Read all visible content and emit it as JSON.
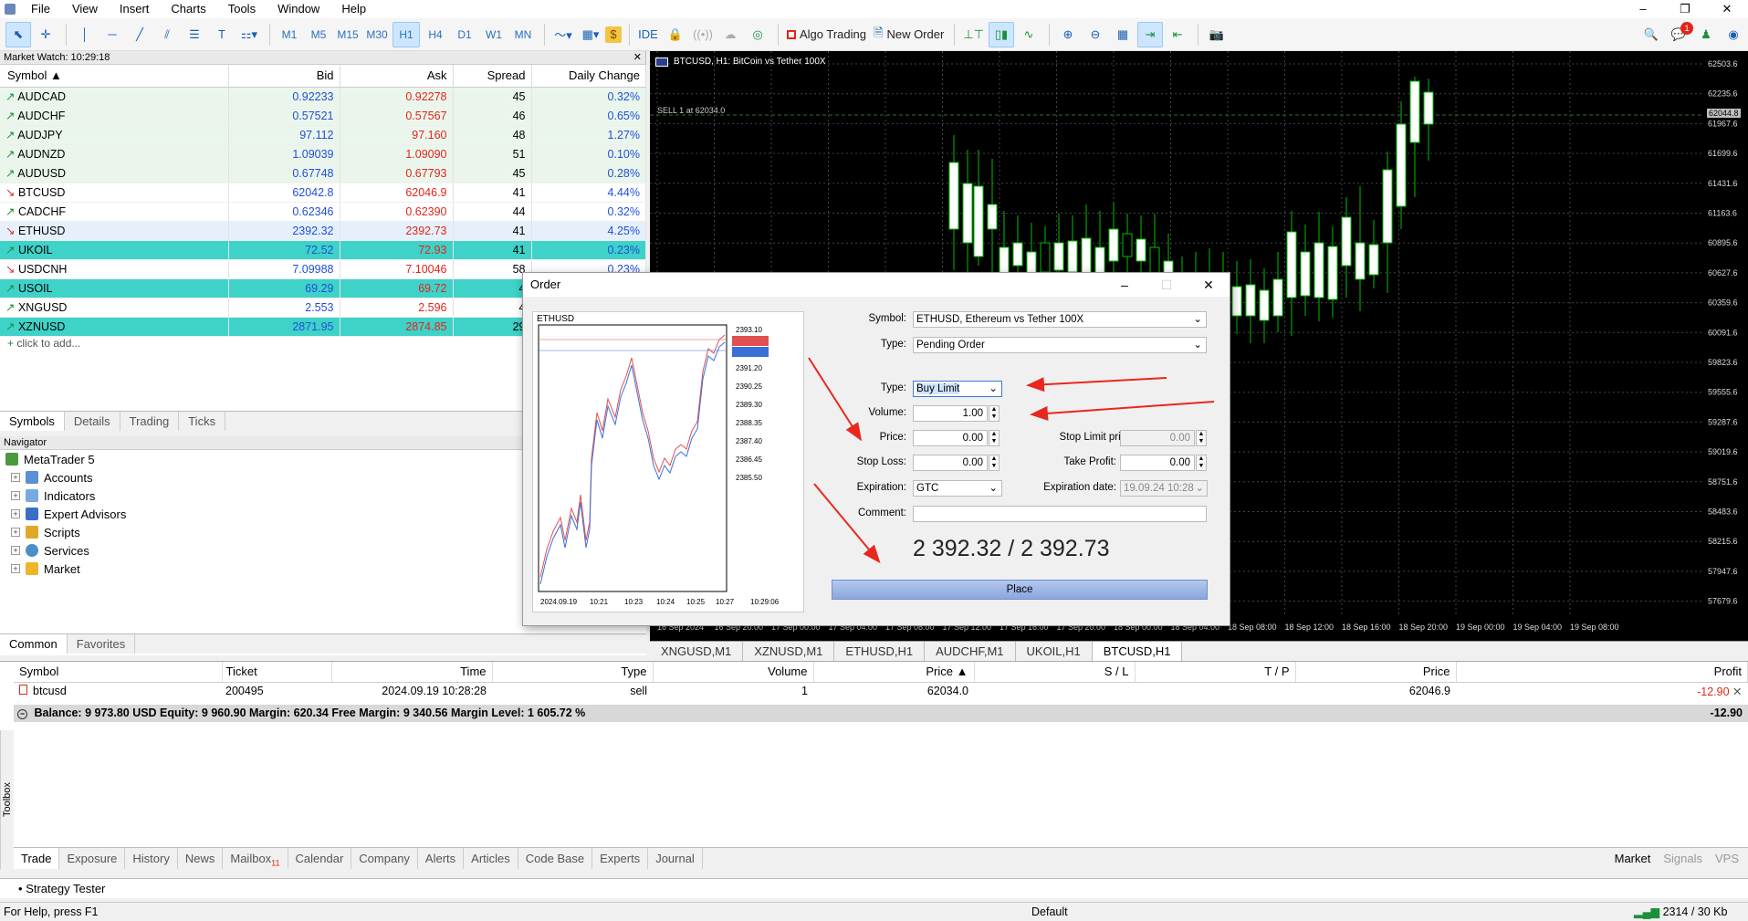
{
  "menu": [
    "File",
    "View",
    "Insert",
    "Charts",
    "Tools",
    "Window",
    "Help"
  ],
  "toolbar": {
    "timeframes": [
      "M1",
      "M5",
      "M15",
      "M30",
      "H1",
      "H4",
      "D1",
      "W1",
      "MN"
    ],
    "active_timeframe": "H1",
    "ide": "IDE",
    "algo": "Algo Trading",
    "new_order": "New Order",
    "notif_count": "1"
  },
  "market_watch": {
    "title": "Market Watch: 10:29:18",
    "columns": [
      "Symbol",
      "Bid",
      "Ask",
      "Spread",
      "Daily Change"
    ],
    "rows": [
      {
        "symbol": "AUDCAD",
        "bid": "0.92233",
        "ask": "0.92278",
        "spread": "45",
        "change": "0.32%",
        "dir": "up"
      },
      {
        "symbol": "AUDCHF",
        "bid": "0.57521",
        "ask": "0.57567",
        "spread": "46",
        "change": "0.65%",
        "dir": "up"
      },
      {
        "symbol": "AUDJPY",
        "bid": "97.112",
        "ask": "97.160",
        "spread": "48",
        "change": "1.27%",
        "dir": "up"
      },
      {
        "symbol": "AUDNZD",
        "bid": "1.09039",
        "ask": "1.09090",
        "spread": "51",
        "change": "0.10%",
        "dir": "up"
      },
      {
        "symbol": "AUDUSD",
        "bid": "0.67748",
        "ask": "0.67793",
        "spread": "45",
        "change": "0.28%",
        "dir": "up"
      },
      {
        "symbol": "BTCUSD",
        "bid": "62042.8",
        "ask": "62046.9",
        "spread": "41",
        "change": "4.44%",
        "dir": "dn"
      },
      {
        "symbol": "CADCHF",
        "bid": "0.62346",
        "ask": "0.62390",
        "spread": "44",
        "change": "0.32%",
        "dir": "up"
      },
      {
        "symbol": "ETHUSD",
        "bid": "2392.32",
        "ask": "2392.73",
        "spread": "41",
        "change": "4.25%",
        "dir": "dn"
      },
      {
        "symbol": "UKOIL",
        "bid": "72.52",
        "ask": "72.93",
        "spread": "41",
        "change": "0.23%",
        "dir": "up"
      },
      {
        "symbol": "USDCNH",
        "bid": "7.09988",
        "ask": "7.10046",
        "spread": "58",
        "change": "0.23%",
        "dir": "dn"
      },
      {
        "symbol": "USOIL",
        "bid": "69.29",
        "ask": "69.72",
        "spread": "4",
        "change": "",
        "dir": "up"
      },
      {
        "symbol": "XNGUSD",
        "bid": "2.553",
        "ask": "2.596",
        "spread": "4",
        "change": "",
        "dir": "up"
      },
      {
        "symbol": "XZNUSD",
        "bid": "2871.95",
        "ask": "2874.85",
        "spread": "29",
        "change": "",
        "dir": "up"
      }
    ],
    "add": "click to add...",
    "tabs": [
      "Symbols",
      "Details",
      "Trading",
      "Ticks"
    ]
  },
  "navigator": {
    "title": "Navigator",
    "root": "MetaTrader 5",
    "items": [
      "Accounts",
      "Indicators",
      "Expert Advisors",
      "Scripts",
      "Services",
      "Market"
    ],
    "tabs": [
      "Common",
      "Favorites"
    ]
  },
  "chart": {
    "title": "BTCUSD, H1: BitCoin vs Tether 100X",
    "sell_line": "SELL 1 at 62034.0",
    "current_price": "62044.8",
    "price_ticks": [
      "62503.6",
      "62235.6",
      "61967.6",
      "61699.6",
      "61431.6",
      "61163.6",
      "60895.6",
      "60627.6",
      "60359.6",
      "60091.6",
      "59823.6",
      "59555.6",
      "59287.6",
      "59019.6",
      "58751.6",
      "58483.6",
      "58215.6",
      "57947.6",
      "57679.6"
    ],
    "time_ticks": [
      "16 Sep 2024",
      "16 Sep 20:00",
      "17 Sep 00:00",
      "17 Sep 04:00",
      "17 Sep 08:00",
      "17 Sep 12:00",
      "17 Sep 16:00",
      "17 Sep 20:00",
      "18 Sep 00:00",
      "18 Sep 04:00",
      "18 Sep 08:00",
      "18 Sep 12:00",
      "18 Sep 16:00",
      "18 Sep 20:00",
      "19 Sep 00:00",
      "19 Sep 04:00",
      "19 Sep 08:00"
    ],
    "tabs": [
      "XNGUSD,M1",
      "XZNUSD,M1",
      "ETHUSD,H1",
      "AUDCHF,M1",
      "UKOIL,H1",
      "BTCUSD,H1"
    ],
    "active_tab": "BTCUSD,H1"
  },
  "order": {
    "title": "Order",
    "symbol_label": "Symbol:",
    "symbol": "ETHUSD, Ethereum vs Tether 100X",
    "type_label": "Type:",
    "type": "Pending Order",
    "subtype_label": "Type:",
    "subtype": "Buy Limit",
    "volume_label": "Volume:",
    "volume": "1.00",
    "price_label": "Price:",
    "price": "0.00",
    "stop_limit_label": "Stop Limit price:",
    "stop_limit": "0.00",
    "sl_label": "Stop Loss:",
    "sl": "0.00",
    "tp_label": "Take Profit:",
    "tp": "0.00",
    "exp_label": "Expiration:",
    "exp": "GTC",
    "exp_date_label": "Expiration date:",
    "exp_date": "19.09.24 10:28",
    "comment_label": "Comment:",
    "quote": "2 392.32 / 2 392.73",
    "place": "Place",
    "mini_symbol": "ETHUSD",
    "mini_prices": [
      "2393.10",
      "2392.73",
      "2392.32",
      "2391.20",
      "2390.25",
      "2389.30",
      "2388.35",
      "2387.40",
      "2386.45",
      "2385.50"
    ],
    "mini_times": [
      "2024.09.19",
      "10:21",
      "10:23",
      "10:24",
      "10:25",
      "10:27",
      "10:29:06"
    ]
  },
  "toolbox": {
    "columns": [
      "Symbol",
      "Ticket",
      "Time",
      "Type",
      "Volume",
      "Price",
      "S / L",
      "T / P",
      "Price",
      "Profit"
    ],
    "row": {
      "symbol": "btcusd",
      "ticket": "200495",
      "time": "2024.09.19 10:28:28",
      "type": "sell",
      "volume": "1",
      "price": "62034.0",
      "sl": "",
      "tp": "",
      "cur": "62046.9",
      "profit": "-12.90"
    },
    "balance": "Balance: 9 973.80 USD  Equity: 9 960.90  Margin: 620.34  Free Margin: 9 340.56  Margin Level: 1 605.72 %",
    "balance_profit": "-12.90",
    "tabs": [
      "Trade",
      "Exposure",
      "History",
      "News",
      "Mailbox",
      "Calendar",
      "Company",
      "Alerts",
      "Articles",
      "Code Base",
      "Experts",
      "Journal"
    ],
    "mailbox_count": "11",
    "right": [
      "Market",
      "Signals",
      "VPS"
    ],
    "side": "Toolbox"
  },
  "strategy": "Strategy Tester",
  "status": {
    "help": "For Help, press F1",
    "profile": "Default",
    "traffic": "2314 / 30 Kb"
  },
  "colors": {
    "bid_blue": "#1f4fd8",
    "ask_red": "#e0261a",
    "candle_green": "#00c000",
    "highlight": "#3ed2c8",
    "place_btn": "#9cb5e6",
    "arrow": "#e8281e"
  }
}
